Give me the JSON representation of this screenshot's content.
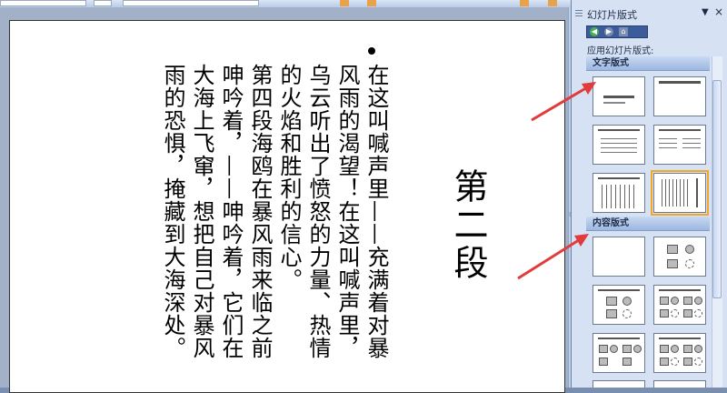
{
  "slide": {
    "title": "第二段",
    "columns": [
      "在这叫喊声里——充满着对暴",
      "风雨的渴望！在这叫喊声里，",
      "乌云听出了愤怒的力量、热情",
      "的火焰和胜利的信心。",
      "第四段海鸥在暴风雨来临之前",
      "呻吟着，——呻吟着，它们在",
      "大海上飞窜，想把自己对暴风",
      "雨的恐惧，掩藏到大海深处。"
    ]
  },
  "task_pane": {
    "title": "幻灯片版式",
    "apply_label": "应用幻灯片版式:",
    "section_text_layouts": "文字版式",
    "section_content_layouts": "内容版式"
  },
  "icons": [
    "back-icon",
    "forward-icon",
    "home-icon",
    "dropdown-arrow-icon",
    "close-icon"
  ],
  "colors": {
    "accent": "#f5a623",
    "pane_bg": "#d6e2f4",
    "arrow": "#e23b3b"
  }
}
